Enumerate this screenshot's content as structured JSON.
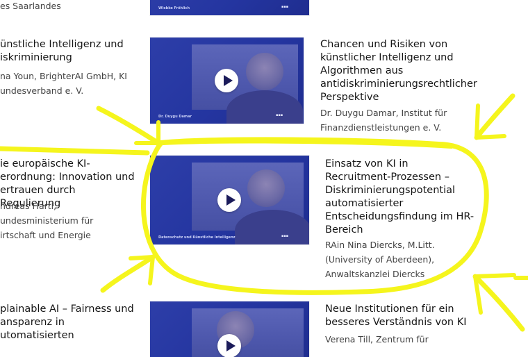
{
  "rows": [
    {
      "left_title": "",
      "left_meta": "es Saarlandes",
      "thumb_caption": "Wiebke Fröhlich",
      "right_title": "",
      "right_meta": ""
    },
    {
      "left_title": "ünstliche Intelligenz und\niskriminierung",
      "left_meta": "na Youn, BrighterAI GmbH, KI\nundesverband e. V.",
      "thumb_caption": "Dr. Duygu Damar",
      "right_title": "Chancen und Risiken von\nkünstlicher Intelligenz und\nAlgorithmen aus\nantidiskriminierungsrechtlicher\nPerspektive",
      "right_meta": "Dr. Duygu Damar, Institut für\nFinanzdienstleistungen e. V."
    },
    {
      "left_title": "ie europäische KI-\nerordnung: Innovation und\nertrauen durch Regulierung",
      "left_meta": "ndreas Hartl,\nundesministerium für\nirtschaft und Energie",
      "thumb_caption": "Datenschutz und Künstliche Intelligenz",
      "right_title": "Einsatz von KI in\nRecruitment-Prozessen –\nDiskriminierungspotential\nautomatisierter\nEntscheidungsfindung im HR-\nBereich",
      "right_meta": "RAin Nina Diercks, M.Litt.\n(University of Aberdeen),\nAnwaltskanzlei Diercks"
    },
    {
      "left_title": "plainable AI – Fairness und\nansparenz in\nutomatisierten",
      "left_meta": "",
      "thumb_caption": "",
      "right_title": "Neue Institutionen für ein\nbesseres Verständnis von KI",
      "right_meta": "Verena Till, Zentrum für"
    }
  ],
  "icons": {
    "play": "play-icon"
  },
  "colors": {
    "thumb_blue": "#2435a0",
    "highlight_yellow": "#f5f51d"
  }
}
